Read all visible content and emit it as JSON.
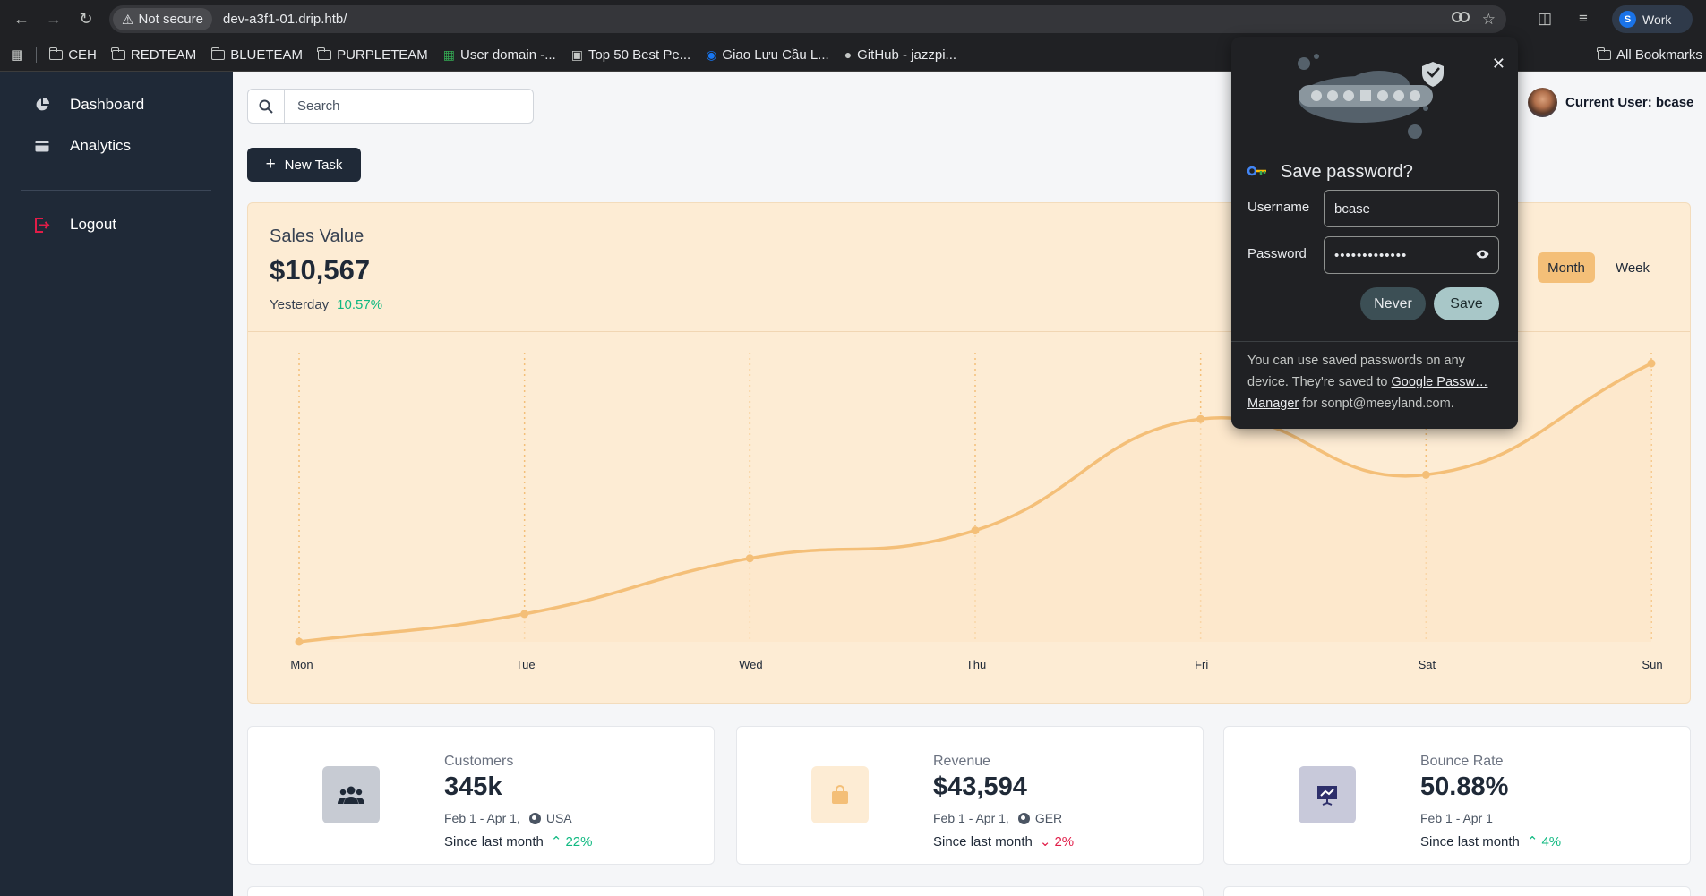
{
  "browser": {
    "security_label": "Not secure",
    "url": "dev-a3f1-01.drip.htb/",
    "profile": "Work",
    "profile_initial": "S",
    "bookmarks": [
      {
        "label": "CEH",
        "icon": "folder-icon"
      },
      {
        "label": "REDTEAM",
        "icon": "folder-icon"
      },
      {
        "label": "BLUETEAM",
        "icon": "folder-icon"
      },
      {
        "label": "PURPLETEAM",
        "icon": "folder-icon"
      },
      {
        "label": "User domain -...",
        "icon": "sheets-icon"
      },
      {
        "label": "Top 50 Best Pe...",
        "icon": "site-icon"
      },
      {
        "label": "Giao Lưu Cầu L...",
        "icon": "facebook-icon"
      },
      {
        "label": "GitHub - jazzpi...",
        "icon": "github-icon"
      }
    ],
    "all_bookmarks": "All Bookmarks"
  },
  "sidebar": {
    "items": [
      {
        "label": "Dashboard",
        "icon": "pie-chart-icon"
      },
      {
        "label": "Analytics",
        "icon": "card-icon"
      },
      {
        "label": "Logout",
        "icon": "logout-icon"
      }
    ]
  },
  "header": {
    "search_placeholder": "Search",
    "new_task": "New Task",
    "current_user": "Current User: bcase"
  },
  "chart": {
    "title": "Sales Value",
    "value": "$10,567",
    "period_label": "Yesterday",
    "change": "10.57%",
    "toggle": [
      "Month",
      "Week"
    ],
    "active_toggle": "Month",
    "accent_color": "#f4bf78",
    "fill_color": "#fdecd4"
  },
  "chart_data": {
    "type": "area",
    "categories": [
      "Mon",
      "Tue",
      "Wed",
      "Thu",
      "Fri",
      "Sat",
      "Sun"
    ],
    "values": [
      0,
      10,
      30,
      40,
      80,
      60,
      100
    ],
    "ylim": [
      0,
      100
    ],
    "grid": "vertical-dotted"
  },
  "stats": [
    {
      "label": "Customers",
      "value": "345k",
      "date": "Feb 1 - Apr 1,",
      "region": "USA",
      "since": "Since last month",
      "change": "22%",
      "direction": "up",
      "icon": "users-icon",
      "tile_color": "#c7cbd3"
    },
    {
      "label": "Revenue",
      "value": "$43,594",
      "date": "Feb 1 - Apr 1,",
      "region": "GER",
      "since": "Since last month",
      "change": "2%",
      "direction": "down",
      "icon": "shopping-bag-icon",
      "tile_color": "#fdecd4"
    },
    {
      "label": "Bounce Rate",
      "value": "50.88%",
      "date": "Feb 1 - Apr 1",
      "region": "",
      "since": "Since last month",
      "change": "4%",
      "direction": "up",
      "icon": "presentation-chart-icon",
      "tile_color": "#c8c9da"
    }
  ],
  "password_prompt": {
    "title": "Save password?",
    "username_label": "Username",
    "username_value": "bcase",
    "password_label": "Password",
    "password_mask": "•••••••••••••",
    "never": "Never",
    "save": "Save",
    "footer_text": "You can use saved passwords on any device. They're saved to",
    "footer_link": "Google Passw… Manager",
    "footer_tail": "for sonpt@meeyland.com."
  }
}
